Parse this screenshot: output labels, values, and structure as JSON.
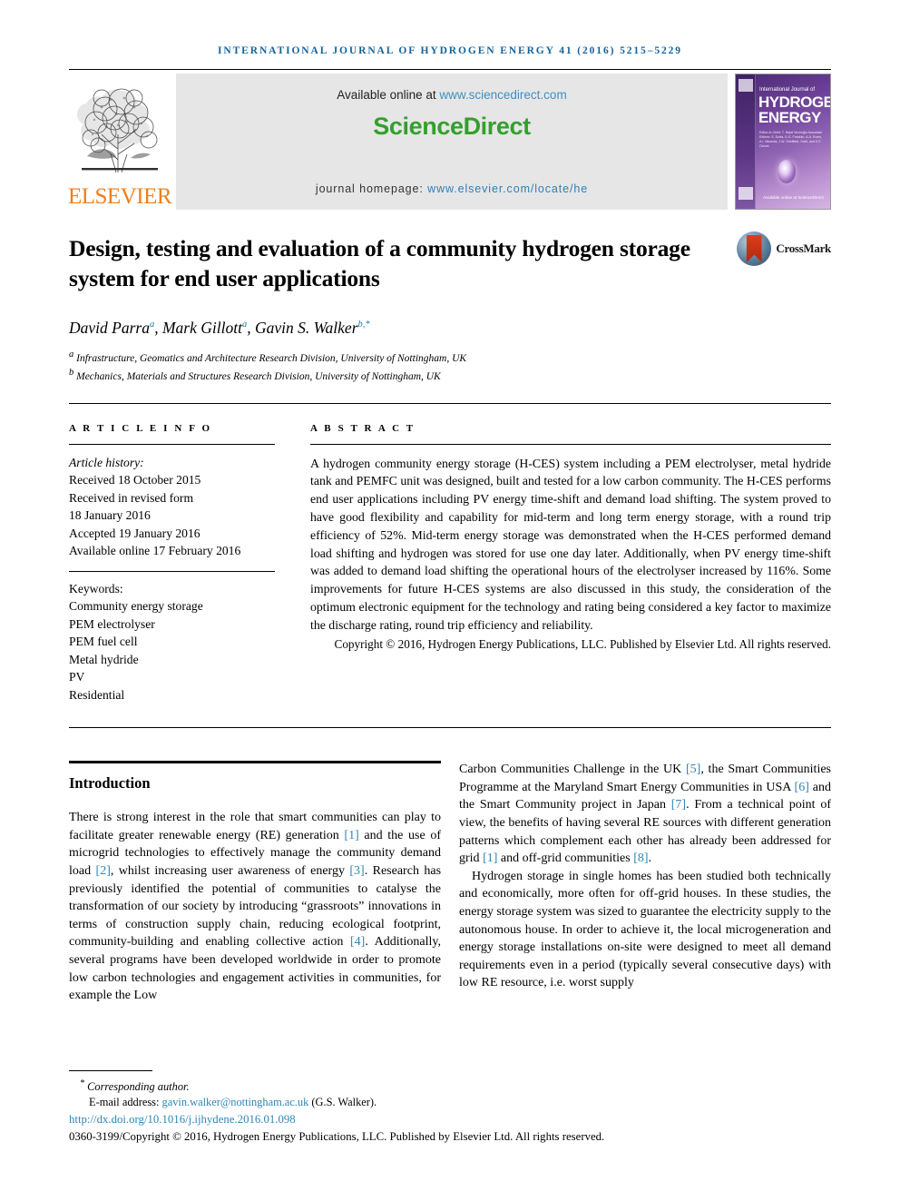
{
  "running_head": "International Journal of Hydrogen Energy 41 (2016) 5215–5229",
  "masthead": {
    "publisher": "ELSEVIER",
    "available_prefix": "Available online at ",
    "available_link": "www.sciencedirect.com",
    "sciencedirect_logo": "ScienceDirect",
    "homepage_prefix": "journal homepage: ",
    "homepage_link": "www.elsevier.com/locate/he",
    "cover": {
      "subtitle": "International Journal of",
      "line1": "HYDROGEN",
      "line2": "ENERGY",
      "editors": "Editor-in-Chief: T. Nejat Veziroğlu   Associate Editors: S. Dutta, D.G. Franklin, A.A. Evers, A.I. Miranda, J.W. Sheffield, Gaël, and E.E. Ozturk",
      "sciencedirect_mark": "Available online at ScienceDirect"
    },
    "colors": {
      "running_head": "#12649c",
      "elsevier_orange": "#ef7f1a",
      "sciencedirect_green": "#33a02c",
      "link_blue": "#2f7fb5",
      "panel_gray": "#e6e6e6"
    }
  },
  "article": {
    "title": "Design, testing and evaluation of a community hydrogen storage system for end user applications",
    "crossmark_label": "CrossMark",
    "authors": [
      {
        "name": "David Parra",
        "sup": "a"
      },
      {
        "name": "Mark Gillott",
        "sup": "a"
      },
      {
        "name": "Gavin S. Walker",
        "sup": "b,*"
      }
    ],
    "authors_line": "David Parra a, Mark Gillott a, Gavin S. Walker b,*",
    "affiliations": [
      {
        "sup": "a",
        "text": "Infrastructure, Geomatics and Architecture Research Division, University of Nottingham, UK"
      },
      {
        "sup": "b",
        "text": "Mechanics, Materials and Structures Research Division, University of Nottingham, UK"
      }
    ]
  },
  "article_info": {
    "label": "A R T I C L E   I N F O",
    "history_label": "Article history:",
    "history": [
      "Received 18 October 2015",
      "Received in revised form",
      "18 January 2016",
      "Accepted 19 January 2016",
      "Available online 17 February 2016"
    ],
    "keywords_label": "Keywords:",
    "keywords": [
      "Community energy storage",
      "PEM electrolyser",
      "PEM fuel cell",
      "Metal hydride",
      "PV",
      "Residential"
    ]
  },
  "abstract": {
    "label": "A B S T R A C T",
    "text": "A hydrogen community energy storage (H-CES) system including a PEM electrolyser, metal hydride tank and PEMFC unit was designed, built and tested for a low carbon community. The H-CES performs end user applications including PV energy time-shift and demand load shifting. The system proved to have good flexibility and capability for mid-term and long term energy storage, with a round trip efficiency of 52%. Mid-term energy storage was demonstrated when the H-CES performed demand load shifting and hydrogen was stored for use one day later. Additionally, when PV energy time-shift was added to demand load shifting the operational hours of the electrolyser increased by 116%. Some improvements for future H-CES systems are also discussed in this study, the consideration of the optimum electronic equipment for the technology and rating being considered a key factor to maximize the discharge rating, round trip efficiency and reliability.",
    "copyright": "Copyright © 2016, Hydrogen Energy Publications, LLC. Published by Elsevier Ltd. All rights reserved."
  },
  "introduction": {
    "heading": "Introduction",
    "para1_left": "There is strong interest in the role that smart communities can play to facilitate greater renewable energy (RE) generation [1] and the use of microgrid technologies to effectively manage the community demand load [2], whilst increasing user awareness of energy [3]. Research has previously identified the potential of communities to catalyse the transformation of our society by introducing “grassroots” innovations in terms of construction supply chain, reducing ecological footprint, community-building and enabling collective action [4]. Additionally, several programs have been developed worldwide in order to promote low carbon technologies and engagement activities in communities, for example the Low",
    "para1_right": "Carbon Communities Challenge in the UK [5], the Smart Communities Programme at the Maryland Smart Energy Communities in USA [6] and the Smart Community project in Japan [7]. From a technical point of view, the benefits of having several RE sources with different generation patterns which complement each other has already been addressed for grid [1] and off-grid communities [8].",
    "para2_right": "Hydrogen storage in single homes has been studied both technically and economically, more often for off-grid houses. In these studies, the energy storage system was sized to guarantee the electricity supply to the autonomous house. In order to achieve it, the local microgeneration and energy storage installations on-site were designed to meet all demand requirements even in a period (typically several consecutive days) with low RE resource, i.e. worst supply"
  },
  "footer": {
    "corresponding": "Corresponding author.",
    "email_label": "E-mail address: ",
    "email": "gavin.walker@nottingham.ac.uk",
    "email_suffix": " (G.S. Walker).",
    "doi": "http://dx.doi.org/10.1016/j.ijhydene.2016.01.098",
    "copyright_line": "0360-3199/Copyright © 2016, Hydrogen Energy Publications, LLC. Published by Elsevier Ltd. All rights reserved."
  }
}
